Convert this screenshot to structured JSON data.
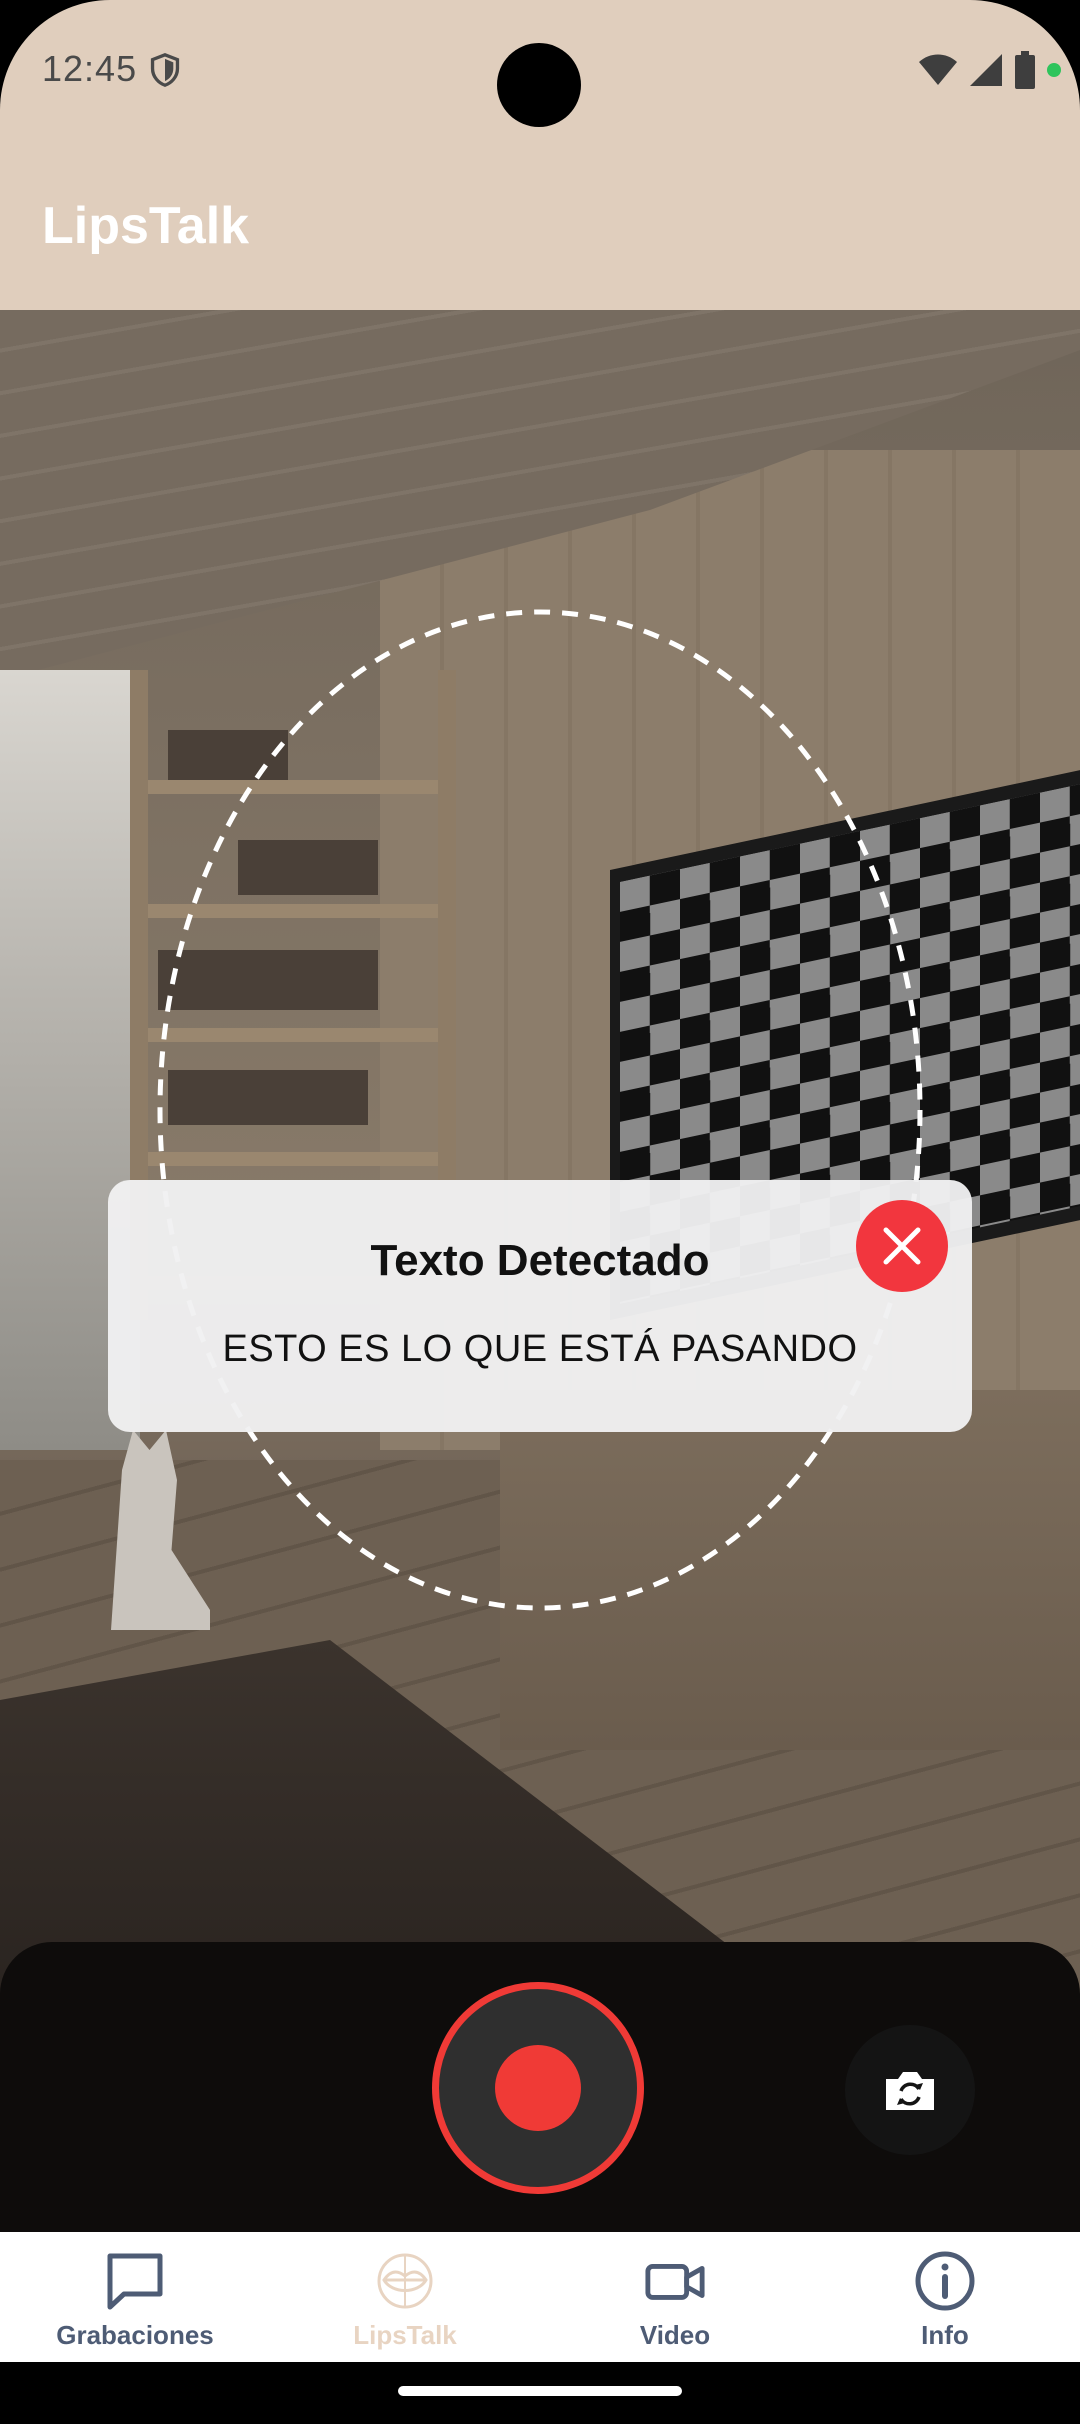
{
  "status_bar": {
    "time": "12:45",
    "icons": [
      "shield-icon",
      "wifi-icon",
      "signal-icon",
      "battery-icon",
      "privacy-dot"
    ]
  },
  "app_bar": {
    "title": "LipsTalk"
  },
  "dialog": {
    "title": "Texto Detectado",
    "text": "ESTO ES LO QUE ESTÁ PASANDO",
    "close_icon": "close-icon"
  },
  "controls": {
    "record_icon": "record-icon",
    "flip_icon": "camera-flip-icon"
  },
  "bottom_nav": {
    "items": [
      {
        "label": "Grabaciones",
        "icon": "chat-icon",
        "active": false
      },
      {
        "label": "LipsTalk",
        "icon": "lips-icon",
        "active": true
      },
      {
        "label": "Video",
        "icon": "video-icon",
        "active": false
      },
      {
        "label": "Info",
        "icon": "info-icon",
        "active": false
      }
    ]
  },
  "colors": {
    "app_bar": "#e0cebd",
    "record": "#f03a36",
    "close": "#f2363e",
    "nav_label": "#4e5c75",
    "nav_active": "#e8d4c2"
  }
}
